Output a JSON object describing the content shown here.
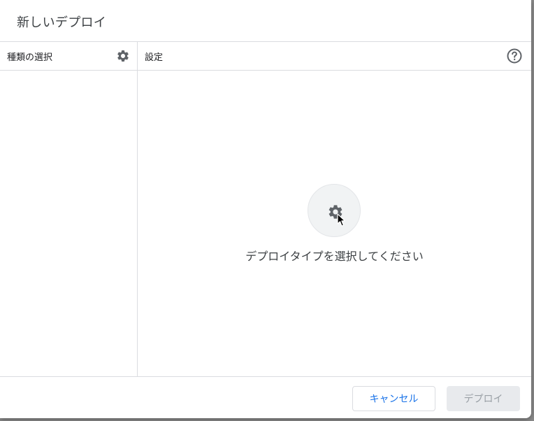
{
  "dialog": {
    "title": "新しいデプロイ",
    "left_pane": {
      "title": "種類の選択",
      "settings_icon": "gear-icon"
    },
    "right_pane": {
      "title": "設定",
      "help_icon": "help-circle-icon",
      "empty_state": {
        "icon": "gear-icon",
        "message": "デプロイタイプを選択してください"
      }
    },
    "footer": {
      "cancel_label": "キャンセル",
      "deploy_label": "デプロイ"
    }
  },
  "colors": {
    "accent": "#1a73e8",
    "divider": "#dadce0",
    "text_primary": "#202124",
    "disabled_bg": "#e8eaed",
    "disabled_text": "#9aa0a6"
  }
}
